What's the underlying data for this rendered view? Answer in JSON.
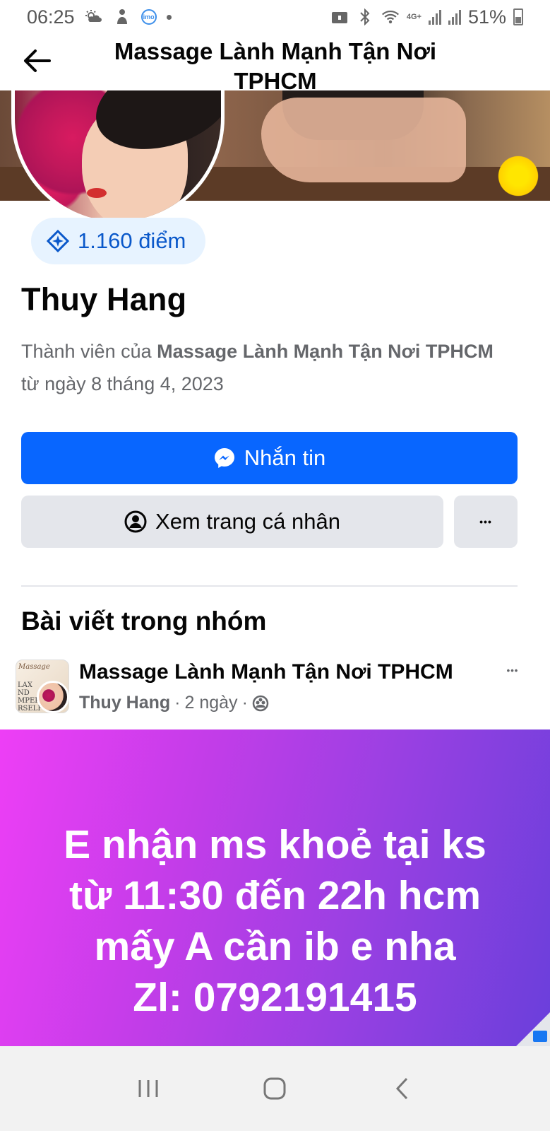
{
  "status_bar": {
    "time": "06:25",
    "battery": "51%",
    "network": "4G+",
    "icons": [
      "weather-icon",
      "game-icon",
      "imo-icon",
      "notification-dot",
      "lock-icon",
      "bluetooth-icon",
      "wifi-icon",
      "signal-icon",
      "battery-icon"
    ],
    "imo_label": "imo"
  },
  "header": {
    "title": "Massage Lành Mạnh Tận Nơi TPHCM",
    "back_icon": "back-arrow-icon"
  },
  "profile": {
    "points": "1.160 điểm",
    "name": "Thuy Hang",
    "member_prefix": "Thành viên của ",
    "member_group": "Massage Lành Mạnh Tận Nơi TPHCM",
    "member_suffix": " từ ngày 8 tháng 4, 2023"
  },
  "buttons": {
    "message": "Nhắn tin",
    "view_profile": "Xem trang cá nhân",
    "more": "•••"
  },
  "section": {
    "title": "Bài viết trong nhóm"
  },
  "post": {
    "group": "Massage Lành Mạnh Tận Nơi TPHCM",
    "author": "Thuy Hang",
    "time": "2 ngày",
    "separator": "·",
    "more": "•••",
    "thumb_text_1": "Massage",
    "thumb_text_2": "LAX\nND\nMPER\nRSELF",
    "lines": [
      "E nhận ms khoẻ tại ks",
      "từ 11:30 đến 22h hcm",
      "mấy A cần ib e nha",
      "Zl: 0792191415"
    ],
    "background": [
      "#ee3ef6",
      "#6a3fdb"
    ]
  },
  "colors": {
    "primary": "#0866ff",
    "secondary_bg": "#e4e6eb",
    "points_bg": "#e7f3ff",
    "points_text": "#0a58ca",
    "meta_text": "#65676b"
  },
  "nav_bar": {
    "icons": [
      "recent-apps-icon",
      "home-icon",
      "back-icon"
    ]
  }
}
